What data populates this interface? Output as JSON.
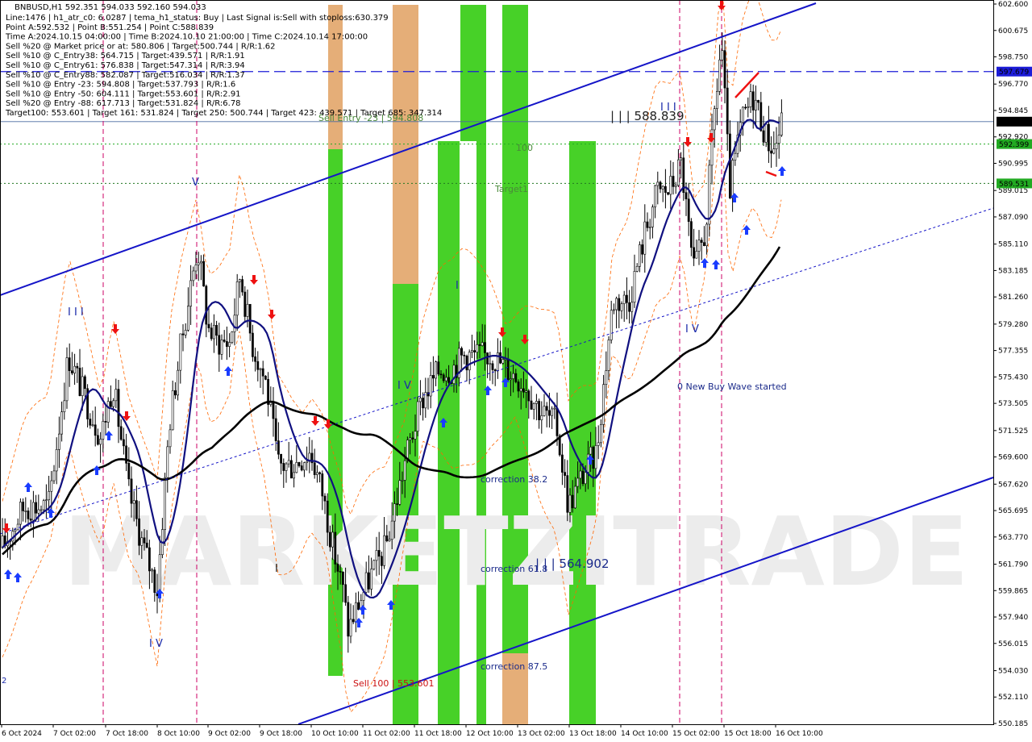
{
  "chart_data": {
    "type": "candlestick",
    "symbol_header": "BNBUSD,H1  592.351 594.033 592.160 594.033",
    "info_lines": [
      "Line:1476 | h1_atr_c0: 6.0287 | tema_h1_status: Buy | Last Signal is:Sell with stoploss:630.379",
      "Point A:592.532 | Point B:551.254 | Point C:588.839",
      "Time A:2024.10.15 04:00:00 | Time B:2024.10.10 21:00:00 | Time C:2024.10.14 17:00:00",
      "Sell %20 @ Market price or at: 580.806 | Target:500.744 | R/R:1.62",
      "Sell %10 @ C_Entry38: 564.715 | Target:439.571 | R/R:1.91",
      "Sell %10 @ C_Entry61: 576.838 | Target:547.314 | R/R:3.94",
      "Sell %10 @ C_Entry88: 582.087 | Target:516.034 | R/R:1.37",
      "Sell %10 @ Entry -23: 594.808 | Target:537.793 | R/R:1.6",
      "Sell %10 @ Entry -50: 604.111 | Target:553.601 | R/R:2.91",
      "Sell %20 @ Entry -88: 617.713 | Target:531.824 | R/R:6.78",
      "Target100: 553.601 | Target 161: 531.824 | Target 250: 500.744 | Target 423: 439.571 | Target 685: 347.314"
    ],
    "y_ticks": [
      "602.600",
      "600.675",
      "598.750",
      "596.770",
      "594.845",
      "592.920",
      "590.995",
      "589.015",
      "587.090",
      "585.110",
      "583.185",
      "581.260",
      "579.280",
      "577.355",
      "575.430",
      "573.505",
      "571.525",
      "569.600",
      "567.620",
      "565.695",
      "563.770",
      "561.790",
      "559.865",
      "557.940",
      "556.015",
      "554.030",
      "552.110",
      "550.185"
    ],
    "ylim": [
      550.185,
      602.6
    ],
    "x_ticks": [
      "6 Oct 2024",
      "7 Oct 02:00",
      "7 Oct 18:00",
      "8 Oct 10:00",
      "9 Oct 02:00",
      "9 Oct 18:00",
      "10 Oct 10:00",
      "11 Oct 02:00",
      "11 Oct 18:00",
      "12 Oct 10:00",
      "13 Oct 02:00",
      "13 Oct 18:00",
      "14 Oct 10:00",
      "15 Oct 02:00",
      "15 Oct 18:00",
      "16 Oct 10:00"
    ],
    "price_tags": [
      {
        "text": "597.679",
        "value": 597.679,
        "bg": "#1c1cd8",
        "fg": "#ffffff"
      },
      {
        "text": "594.033",
        "value": 594.033,
        "bg": "#000000",
        "fg": "#ffffff"
      },
      {
        "text": "592.399",
        "value": 592.399,
        "bg": "#22aa22",
        "fg": "#ffffff"
      },
      {
        "text": "589.531",
        "value": 589.531,
        "bg": "#22aa22",
        "fg": "#ffffff"
      }
    ],
    "annotations": {
      "sell_entry": "Sell Entry -23 | 594.808",
      "target_hidden": "Target 685: 347.314",
      "level_100": "100",
      "target1": "Target1",
      "point_c": "| | | 588.839",
      "point_b": "| | | 564.902",
      "sell100": "Sell 100 | 553.601",
      "corr38": "correction 38.2",
      "corr61": "correction 61.8",
      "corr87": "correction 87.5",
      "new_wave": "0 New Buy Wave started",
      "wave_III": "I I I",
      "wave_IV_left": "I V",
      "wave_IV_mid": "I V",
      "wave_IV_right": "I V",
      "wave_I": "I",
      "wave_V": "V",
      "wave_II": "I",
      "wave_top": "I I I",
      "left_edge": "2"
    },
    "watermark": "MARKETZITRADE",
    "colors": {
      "candle": "#000000",
      "channel": "#1515c8",
      "tema_fast": "#101080",
      "ma_green": "#33cc33",
      "ma_slow": "#000000",
      "envelope": "#ff6600",
      "zone_green": "#33cc11",
      "zone_orange": "#e0a060",
      "buy_arrow": "#1a3cff",
      "sell_arrow": "#ee1111",
      "vline": "#cc0066"
    }
  }
}
